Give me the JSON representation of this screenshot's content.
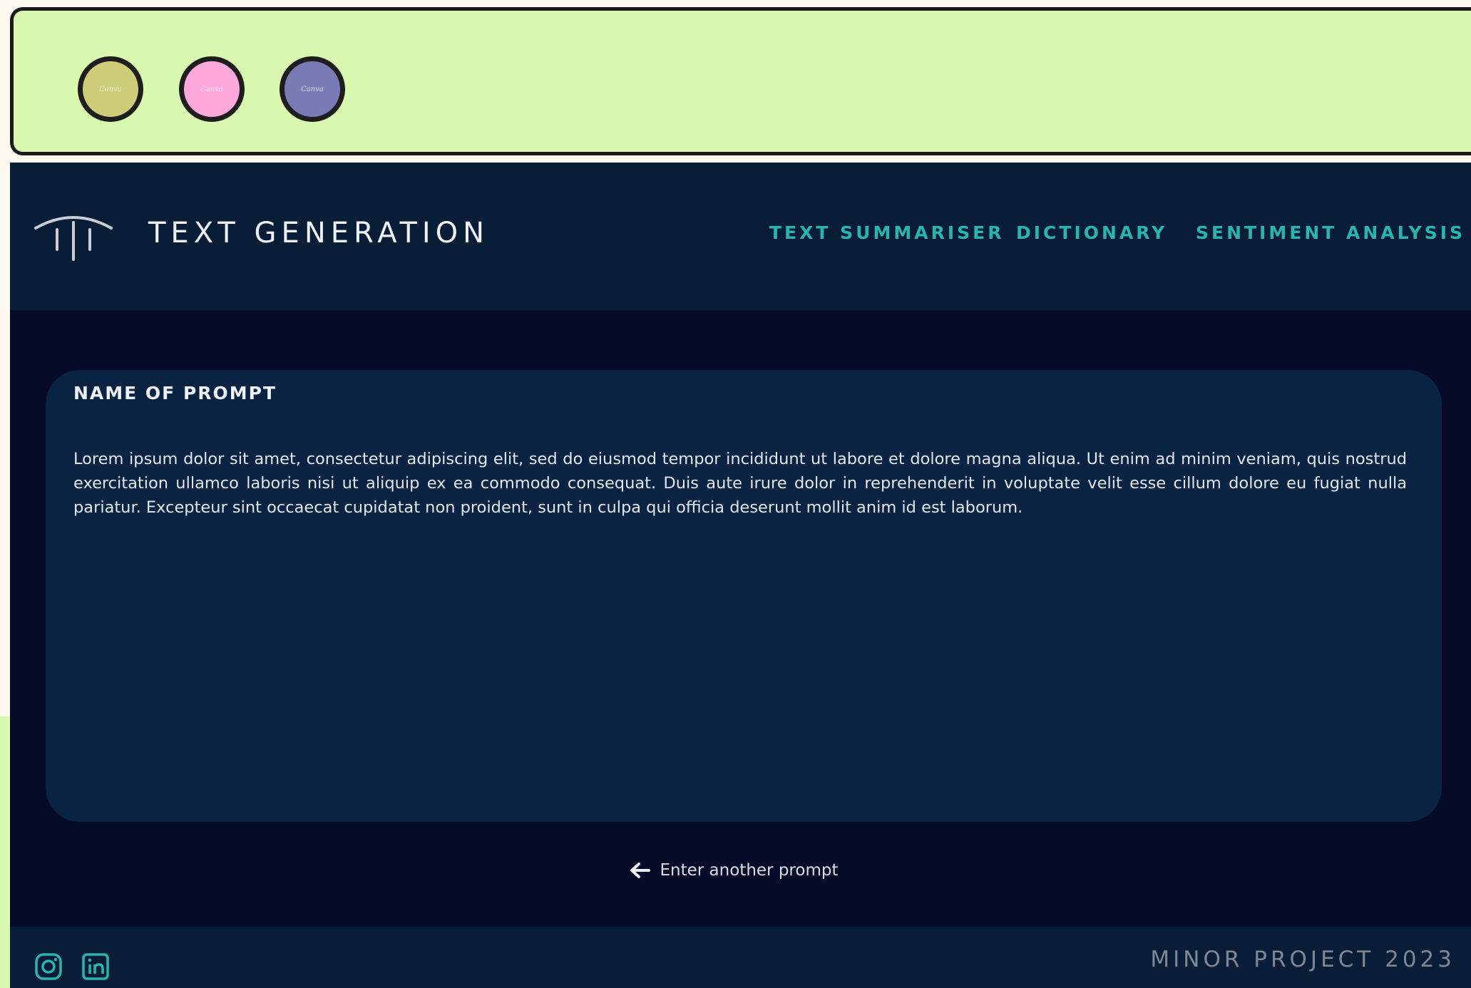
{
  "window": {
    "dots": [
      {
        "name": "olive",
        "color": "#cdcc79",
        "label": "Canva"
      },
      {
        "name": "pink",
        "color": "#ffa8db",
        "label": "Canva"
      },
      {
        "name": "purple",
        "color": "#7a7ab4",
        "label": "Canva"
      }
    ],
    "bar_color": "#d9f9b1"
  },
  "header": {
    "brand": "TEXT GENERATION",
    "logo_icon": "pillar-logo-icon",
    "nav": [
      {
        "label": "TEXT SUMMARISER"
      },
      {
        "label": "DICTIONARY"
      },
      {
        "label": "SENTIMENT ANALYSIS"
      }
    ],
    "accent_color": "#28b5b0",
    "background": "#0a1d37"
  },
  "card": {
    "title": "NAME OF PROMPT",
    "body": "Lorem ipsum dolor sit amet, consectetur adipiscing elit, sed do eiusmod tempor incididunt ut labore et dolore magna aliqua. Ut enim ad minim veniam, quis nostrud exercitation ullamco laboris nisi ut aliquip ex ea commodo consequat. Duis aute irure dolor in reprehenderit in voluptate velit esse cillum dolore eu fugiat nulla pariatur. Excepteur sint occaecat cupidatat non proident, sunt in culpa qui officia deserunt mollit anim id est laborum.",
    "background": "#0a2342"
  },
  "actions": {
    "back_label": "Enter another prompt",
    "back_icon": "arrow-left-icon"
  },
  "footer": {
    "text": "MINOR PROJECT 2023",
    "social": [
      {
        "name": "instagram-icon"
      },
      {
        "name": "linkedin-icon"
      }
    ]
  },
  "page_background": "#060c27"
}
